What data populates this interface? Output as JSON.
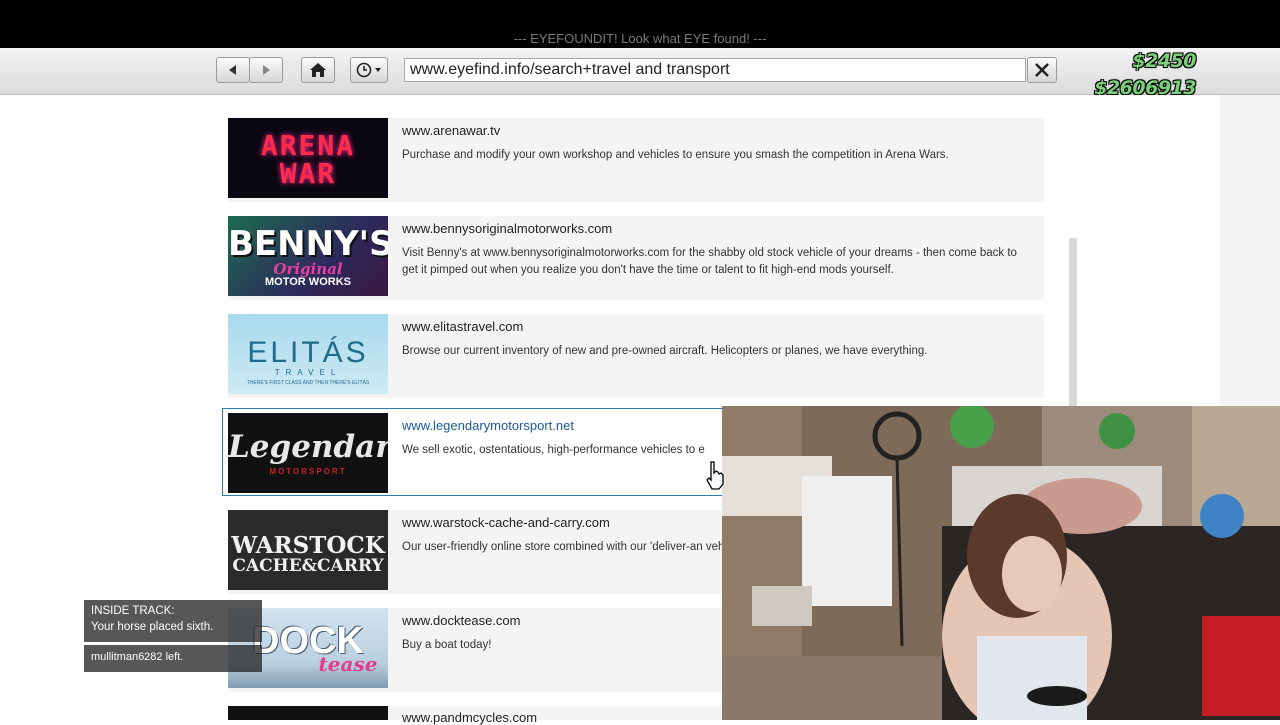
{
  "banner": "--- EYEFOUNDIT! Look what EYE found! ---",
  "url": "www.eyefind.info/search+travel and transport",
  "money": {
    "cash": "$2450",
    "bank": "$2606913",
    "color": "#7ad07a"
  },
  "results": [
    {
      "url": "www.arenawar.tv",
      "desc": "Purchase and modify your own workshop and vehicles to ensure you smash the competition in Arena Wars.",
      "thumb": "ARENA WAR"
    },
    {
      "url": "www.bennysoriginalmotorworks.com",
      "desc": "Visit Benny's at www.bennysoriginalmotorworks.com for the shabby old stock vehicle of your dreams - then come back to get it pimped out when you realize you don't have the time or talent to fit high-end mods yourself.",
      "thumb": "BENNY'S",
      "thumb_sub": "Original",
      "thumb_sub2": "MOTOR WORKS"
    },
    {
      "url": "www.elitastravel.com",
      "desc": "Browse our current inventory of new and pre-owned aircraft. Helicopters or planes, we have everything.",
      "thumb": "ELITÁS",
      "thumb_sub": "TRAVEL",
      "thumb_sub2": "THERE'S FIRST CLASS AND THEN THERE'S ELITÁS"
    },
    {
      "url": "www.legendarymotorsport.net",
      "desc": "We sell exotic, ostentatious, high-performance vehicles to e",
      "thumb": "Legendary",
      "thumb_sub": "MOTORSPORT"
    },
    {
      "url": "www.warstock-cache-and-carry.com",
      "desc": "Our user-friendly online store combined with our 'deliver-an vehicle dealer in the Los Santos area.",
      "thumb": "WARSTOCK",
      "thumb_sub": "CACHE&CARRY"
    },
    {
      "url": "www.docktease.com",
      "desc": "Buy a boat today!",
      "thumb": "DOCK",
      "thumb_sub": "tease"
    },
    {
      "url": "www.pandmcycles.com",
      "desc": ""
    }
  ],
  "notifications": {
    "title": "INSIDE TRACK:",
    "message": "Your horse placed sixth.",
    "player": "mullitman6282",
    "player_suffix": " left."
  }
}
